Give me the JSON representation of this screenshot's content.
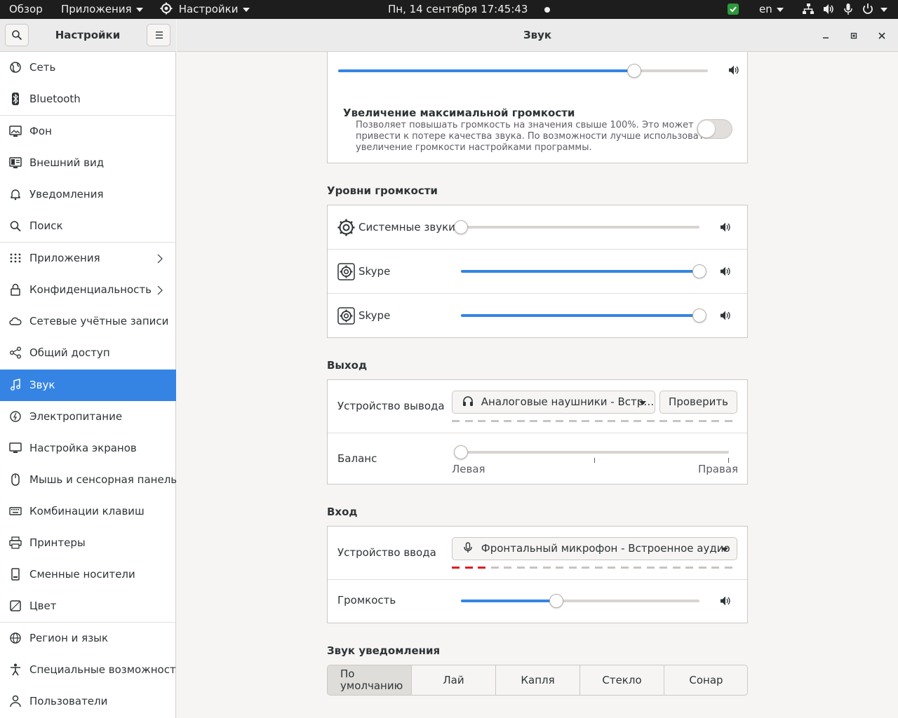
{
  "topbar": {
    "overview": "Обзор",
    "apps": "Приложения",
    "settings_app": "Настройки",
    "clock": "Пн, 14 сентября  17:45:43",
    "lang": "en"
  },
  "sidebar": {
    "title": "Настройки",
    "items": [
      {
        "label": "Сеть",
        "icon": "network-icon"
      },
      {
        "label": "Bluetooth",
        "icon": "bluetooth-icon"
      },
      {
        "label": "Фон",
        "icon": "background-icon"
      },
      {
        "label": "Внешний вид",
        "icon": "appearance-icon"
      },
      {
        "label": "Уведомления",
        "icon": "bell-icon"
      },
      {
        "label": "Поиск",
        "icon": "search-icon"
      },
      {
        "label": "Приложения",
        "icon": "apps-grid-icon"
      },
      {
        "label": "Конфиденциальность",
        "icon": "lock-icon"
      },
      {
        "label": "Сетевые учётные записи",
        "icon": "cloud-icon"
      },
      {
        "label": "Общий доступ",
        "icon": "share-icon"
      },
      {
        "label": "Звук",
        "icon": "music-note-icon"
      },
      {
        "label": "Электропитание",
        "icon": "power-icon"
      },
      {
        "label": "Настройка экранов",
        "icon": "display-icon"
      },
      {
        "label": "Мышь и сенсорная панель",
        "icon": "mouse-icon"
      },
      {
        "label": "Комбинации клавиш",
        "icon": "keyboard-icon"
      },
      {
        "label": "Принтеры",
        "icon": "printer-icon"
      },
      {
        "label": "Сменные носители",
        "icon": "removable-media-icon"
      },
      {
        "label": "Цвет",
        "icon": "color-icon"
      },
      {
        "label": "Регион и язык",
        "icon": "globe-icon"
      },
      {
        "label": "Специальные возможности",
        "icon": "accessibility-icon"
      },
      {
        "label": "Пользователи",
        "icon": "users-icon"
      }
    ]
  },
  "window": {
    "title": "Звук"
  },
  "master_volume": {
    "level": 0.8
  },
  "overamp": {
    "title": "Увеличение максимальной громкости",
    "desc1": "Позволяет повышать громкость на значения свыше 100%. Это может",
    "desc2": "привести к потере качества звука. По возможности лучше использовать",
    "desc3": "увеличение громкости настройками программы.",
    "enabled": false
  },
  "levels": {
    "title": "Уровни громкости",
    "rows": [
      {
        "name": "Системные звуки",
        "level": 0.0
      },
      {
        "name": "Skype",
        "level": 1.0
      },
      {
        "name": "Skype",
        "level": 1.0
      }
    ]
  },
  "output": {
    "title": "Выход",
    "device_label": "Устройство вывода",
    "device_value": "Аналоговые наушники - Встр…",
    "test_button": "Проверить",
    "balance_label": "Баланс",
    "balance_left": "Левая",
    "balance_right": "Правая",
    "balance": 0.0
  },
  "input": {
    "title": "Вход",
    "device_label": "Устройство ввода",
    "device_value": "Фронтальный микрофон - Встроенное аудио",
    "volume_label": "Громкость",
    "volume": 0.4,
    "input_level_segments": 3
  },
  "alert": {
    "title": "Звук уведомления",
    "options": [
      "По умолчанию",
      "Лай",
      "Капля",
      "Стекло",
      "Сонар"
    ],
    "selected": 0
  }
}
